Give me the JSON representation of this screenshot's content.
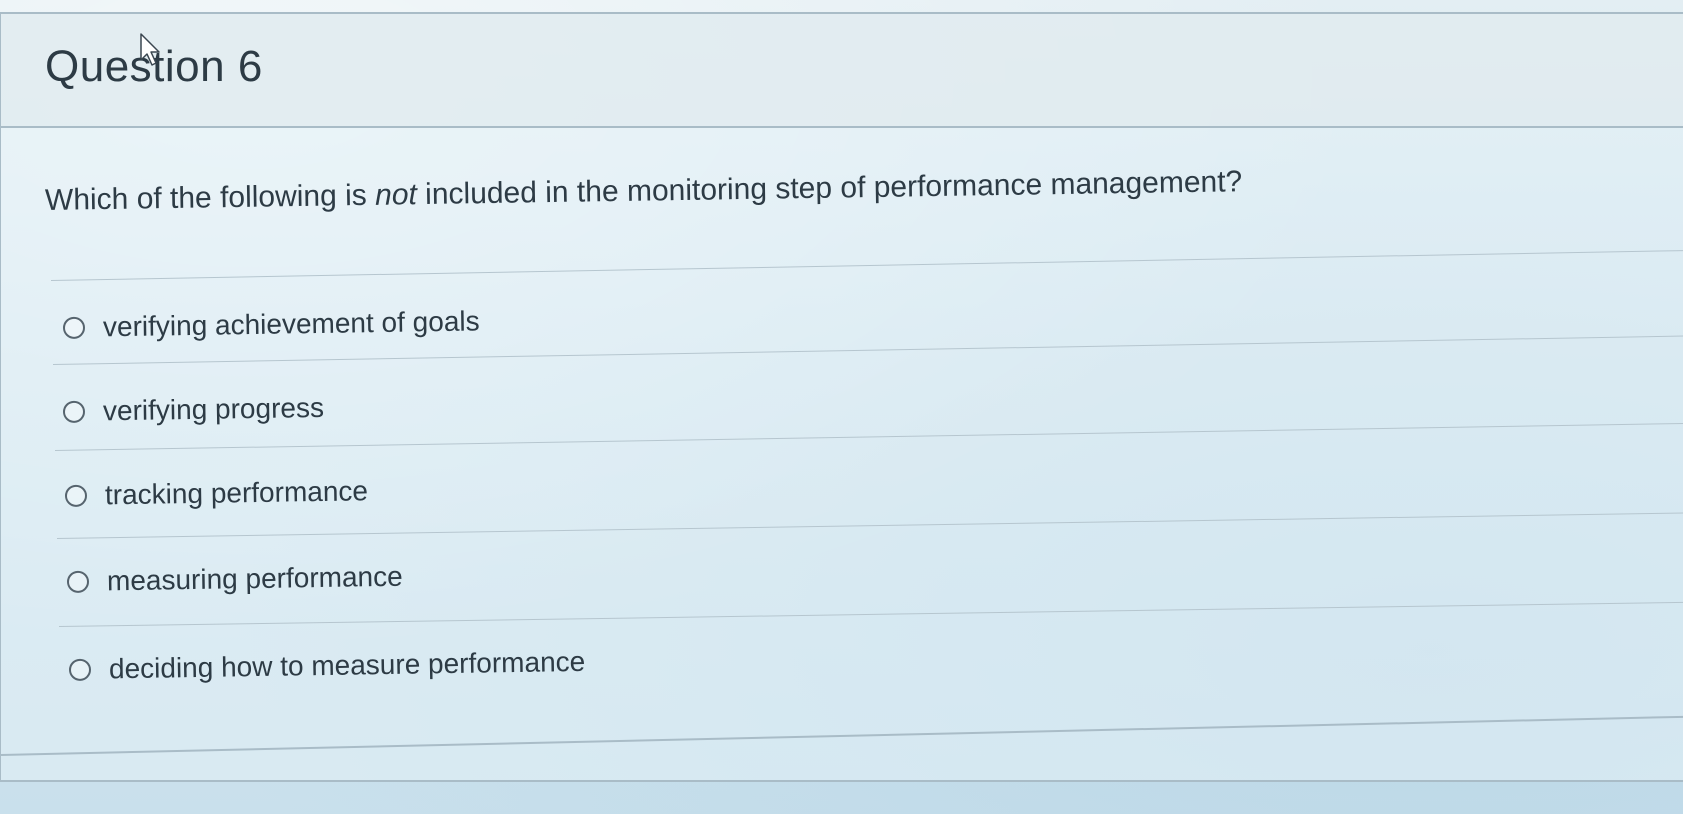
{
  "question": {
    "title": "Question 6",
    "text_before": "Which of the following is ",
    "text_emphasis": "not",
    "text_after": " included in the monitoring step of performance management?"
  },
  "answers": [
    {
      "label": "verifying achievement of goals",
      "selected": false
    },
    {
      "label": "verifying progress",
      "selected": false
    },
    {
      "label": "tracking performance",
      "selected": false
    },
    {
      "label": "measuring performance",
      "selected": false
    },
    {
      "label": "deciding how to measure performance",
      "selected": false
    }
  ],
  "icons": {
    "cursor": "mouse-pointer-icon",
    "radio": "radio-button-icon"
  },
  "colors": {
    "background": "#d7e7ef",
    "text": "#2d3b45",
    "border": "#a9bcc7"
  }
}
